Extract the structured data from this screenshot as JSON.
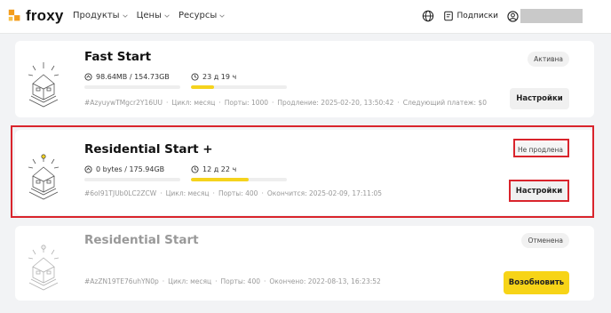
{
  "header": {
    "logo_text": "froxy",
    "nav": [
      {
        "label": "Продукты"
      },
      {
        "label": "Цены"
      },
      {
        "label": "Ресурсы"
      }
    ],
    "subscriptions_label": "Подписки"
  },
  "colors": {
    "accent_yellow": "#f5d31d",
    "logo_orange": "#f39c1b",
    "highlight_red": "#d9242c"
  },
  "cards": [
    {
      "title": "Fast Start",
      "traffic": "98.64MB / 154.73GB",
      "traffic_fraction": 0.0006,
      "time_left": "23 д 19 ч",
      "time_fraction": 0.24,
      "id": "#AzyuywTMgcr2Y16UU",
      "cycle": "Цикл: месяц",
      "ports": "Порты: 1000",
      "renewal": "Продление: 2025-02-20, 13:50:42",
      "next_payment": "Следующий платеж: $0",
      "status": "Активна",
      "button": "Настройки"
    },
    {
      "title": "Residential Start +",
      "traffic": "0 bytes / 175.94GB",
      "traffic_fraction": 0,
      "time_left": "12 д 22 ч",
      "time_fraction": 0.6,
      "id": "#6oI91TJUb0LC2ZCW",
      "cycle": "Цикл: месяц",
      "ports": "Порты: 400",
      "ends": "Окончится: 2025-02-09, 17:11:05",
      "status": "Не продлена",
      "button": "Настройки"
    },
    {
      "title": "Residential Start",
      "id": "#AzZN19TE76uhYN0p",
      "cycle": "Цикл: месяц",
      "ports": "Порты: 400",
      "ended": "Окончено: 2022-08-13, 16:23:52",
      "status": "Отменена",
      "button": "Возобновить"
    }
  ]
}
